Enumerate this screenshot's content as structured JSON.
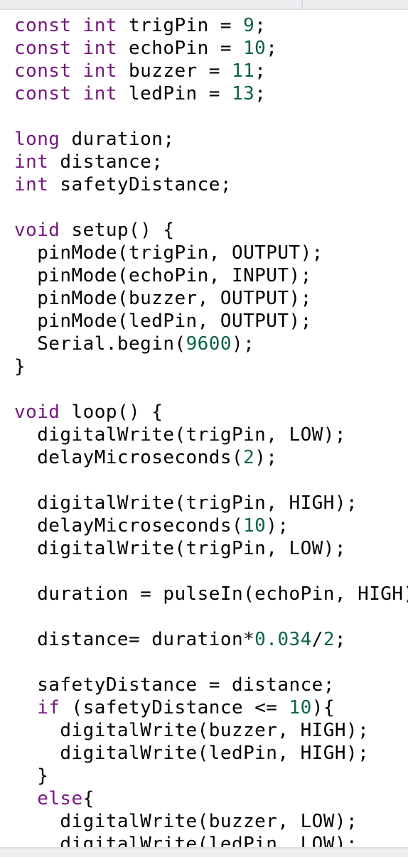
{
  "app": {
    "name": "Arduino IDE Code Editor",
    "theme": "light"
  },
  "colors": {
    "background": "#ffffff",
    "keyword": "#76177f",
    "number": "#0b6348",
    "plain": "#000000",
    "chrome": "#eceef0",
    "chrome_border": "#dcdfe4"
  },
  "tab_bar": {
    "active_tab_label": "",
    "next_tab_label": ""
  },
  "status_bar": {
    "text": ""
  },
  "editor": {
    "language": "cpp",
    "font_size_px": 26,
    "line_height_px": 32,
    "horizontal_overflow": true,
    "lines": [
      [
        {
          "t": "const int",
          "c": "kw"
        },
        {
          "t": " trigPin = ",
          "c": "pln"
        },
        {
          "t": "9",
          "c": "num"
        },
        {
          "t": ";",
          "c": "pln"
        }
      ],
      [
        {
          "t": "const int",
          "c": "kw"
        },
        {
          "t": " echoPin = ",
          "c": "pln"
        },
        {
          "t": "10",
          "c": "num"
        },
        {
          "t": ";",
          "c": "pln"
        }
      ],
      [
        {
          "t": "const int",
          "c": "kw"
        },
        {
          "t": " buzzer = ",
          "c": "pln"
        },
        {
          "t": "11",
          "c": "num"
        },
        {
          "t": ";",
          "c": "pln"
        }
      ],
      [
        {
          "t": "const int",
          "c": "kw"
        },
        {
          "t": " ledPin = ",
          "c": "pln"
        },
        {
          "t": "13",
          "c": "num"
        },
        {
          "t": ";",
          "c": "pln"
        }
      ],
      [],
      [
        {
          "t": "long",
          "c": "kw"
        },
        {
          "t": " duration;",
          "c": "pln"
        }
      ],
      [
        {
          "t": "int",
          "c": "kw"
        },
        {
          "t": " distance;",
          "c": "pln"
        }
      ],
      [
        {
          "t": "int",
          "c": "kw"
        },
        {
          "t": " safetyDistance;",
          "c": "pln"
        }
      ],
      [],
      [
        {
          "t": "void",
          "c": "kw"
        },
        {
          "t": " setup() {",
          "c": "pln"
        }
      ],
      [
        {
          "t": "  pinMode(trigPin, OUTPUT);",
          "c": "pln"
        }
      ],
      [
        {
          "t": "  pinMode(echoPin, INPUT);",
          "c": "pln"
        }
      ],
      [
        {
          "t": "  pinMode(buzzer, OUTPUT);",
          "c": "pln"
        }
      ],
      [
        {
          "t": "  pinMode(ledPin, OUTPUT);",
          "c": "pln"
        }
      ],
      [
        {
          "t": "  Serial.begin(",
          "c": "pln"
        },
        {
          "t": "9600",
          "c": "num"
        },
        {
          "t": ");",
          "c": "pln"
        }
      ],
      [
        {
          "t": "}",
          "c": "pln"
        }
      ],
      [],
      [
        {
          "t": "void",
          "c": "kw"
        },
        {
          "t": " loop() {",
          "c": "pln"
        }
      ],
      [
        {
          "t": "  digitalWrite(trigPin, LOW);",
          "c": "pln"
        }
      ],
      [
        {
          "t": "  delayMicroseconds(",
          "c": "pln"
        },
        {
          "t": "2",
          "c": "num"
        },
        {
          "t": ");",
          "c": "pln"
        }
      ],
      [],
      [
        {
          "t": "  digitalWrite(trigPin, HIGH);",
          "c": "pln"
        }
      ],
      [
        {
          "t": "  delayMicroseconds(",
          "c": "pln"
        },
        {
          "t": "10",
          "c": "num"
        },
        {
          "t": ");",
          "c": "pln"
        }
      ],
      [
        {
          "t": "  digitalWrite(trigPin, LOW);",
          "c": "pln"
        }
      ],
      [],
      [
        {
          "t": "  duration = pulseIn(echoPin, HIGH);",
          "c": "pln"
        }
      ],
      [],
      [
        {
          "t": "  distance= duration*",
          "c": "pln"
        },
        {
          "t": "0.034",
          "c": "num"
        },
        {
          "t": "/",
          "c": "pln"
        },
        {
          "t": "2",
          "c": "num"
        },
        {
          "t": ";",
          "c": "pln"
        }
      ],
      [],
      [
        {
          "t": "  safetyDistance = distance;",
          "c": "pln"
        }
      ],
      [
        {
          "t": "  ",
          "c": "pln"
        },
        {
          "t": "if",
          "c": "kw"
        },
        {
          "t": " (safetyDistance <= ",
          "c": "pln"
        },
        {
          "t": "10",
          "c": "num"
        },
        {
          "t": "){",
          "c": "pln"
        }
      ],
      [
        {
          "t": "    digitalWrite(buzzer, HIGH);",
          "c": "pln"
        }
      ],
      [
        {
          "t": "    digitalWrite(ledPin, HIGH);",
          "c": "pln"
        }
      ],
      [
        {
          "t": "  }",
          "c": "pln"
        }
      ],
      [
        {
          "t": "  ",
          "c": "pln"
        },
        {
          "t": "else",
          "c": "kw"
        },
        {
          "t": "{",
          "c": "pln"
        }
      ],
      [
        {
          "t": "    digitalWrite(buzzer, LOW);",
          "c": "pln"
        }
      ],
      [
        {
          "t": "    digitalWrite(ledPin, LOW);",
          "c": "pln"
        }
      ]
    ]
  }
}
